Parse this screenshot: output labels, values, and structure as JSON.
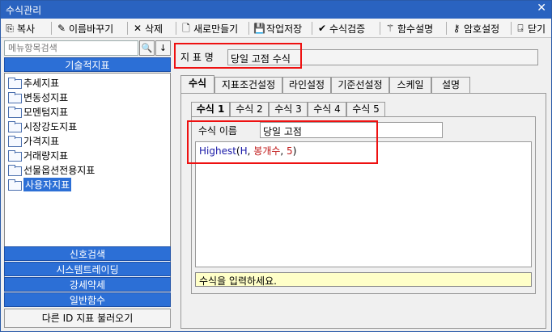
{
  "window": {
    "title": "수식관리",
    "close_label": "✕"
  },
  "toolbar": {
    "copy": "복사",
    "rename": "이름바꾸기",
    "delete": "삭제",
    "new": "새로만들기",
    "save": "작업저장",
    "verify": "수식검증",
    "func_help": "함수설명",
    "password": "암호설정",
    "close": "닫기"
  },
  "left": {
    "search_placeholder": "메뉴항목검색",
    "technical_header": "기술적지표",
    "tree_items": [
      "추세지표",
      "변동성지표",
      "모멘텀지표",
      "시장강도지표",
      "가격지표",
      "거래량지표",
      "선물옵션전용지표",
      "사용자지표"
    ],
    "selected_index": 7,
    "categories": [
      "신호검색",
      "시스템트레이딩",
      "강세약세",
      "일반함수"
    ],
    "load_other_id": "다른 ID 지표 불러오기"
  },
  "right": {
    "indicator_name_label": "지 표 명",
    "indicator_name_value": "당일 고점 수식",
    "tabs": [
      "수식",
      "지표조건설정",
      "라인설정",
      "기준선설정",
      "스케일",
      "설명"
    ],
    "active_tab": 0,
    "subtabs": [
      "수식 1",
      "수식 2",
      "수식 3",
      "수식 4",
      "수식 5"
    ],
    "active_subtab": 0,
    "formula_name_label": "수식 이름",
    "formula_name_value": "당일 고점",
    "formula": {
      "func": "Highest",
      "open": "(",
      "arg1": "H",
      "sep1": ", ",
      "arg2": "봉개수",
      "sep2": ", ",
      "arg3": "5",
      "close": ")"
    },
    "hint": "수식을 입력하세요."
  }
}
